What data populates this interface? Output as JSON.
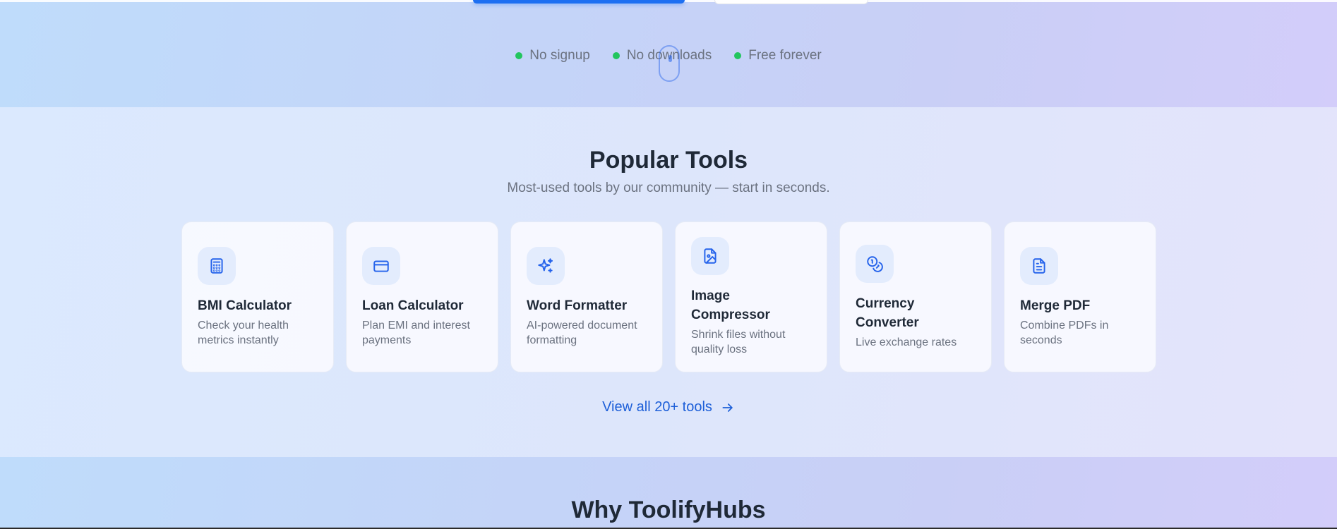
{
  "hero": {
    "badges": [
      {
        "label": "No signup"
      },
      {
        "label": "No downloads"
      },
      {
        "label": "Free forever"
      }
    ]
  },
  "popular": {
    "title": "Popular Tools",
    "subtitle": "Most-used tools by our community — start in seconds.",
    "tools": [
      {
        "name": "BMI Calculator",
        "description": "Check your health metrics instantly",
        "icon": "calculator-icon"
      },
      {
        "name": "Loan Calculator",
        "description": "Plan EMI and interest payments",
        "icon": "credit-card-icon"
      },
      {
        "name": "Word Formatter",
        "description": "AI-powered document formatting",
        "icon": "sparkles-icon"
      },
      {
        "name": "Image Compressor",
        "description": "Shrink files without quality loss",
        "icon": "file-image-icon"
      },
      {
        "name": "Currency Converter",
        "description": "Live exchange rates",
        "icon": "coins-icon"
      },
      {
        "name": "Merge PDF",
        "description": "Combine PDFs in seconds",
        "icon": "file-text-icon"
      }
    ],
    "view_all_label": "View all 20+ tools"
  },
  "why": {
    "title": "Why ToolifyHubs"
  },
  "colors": {
    "accent": "#1d5fd8",
    "badge_dot": "#22c55e",
    "icon_bg": "#e3ecfd"
  }
}
